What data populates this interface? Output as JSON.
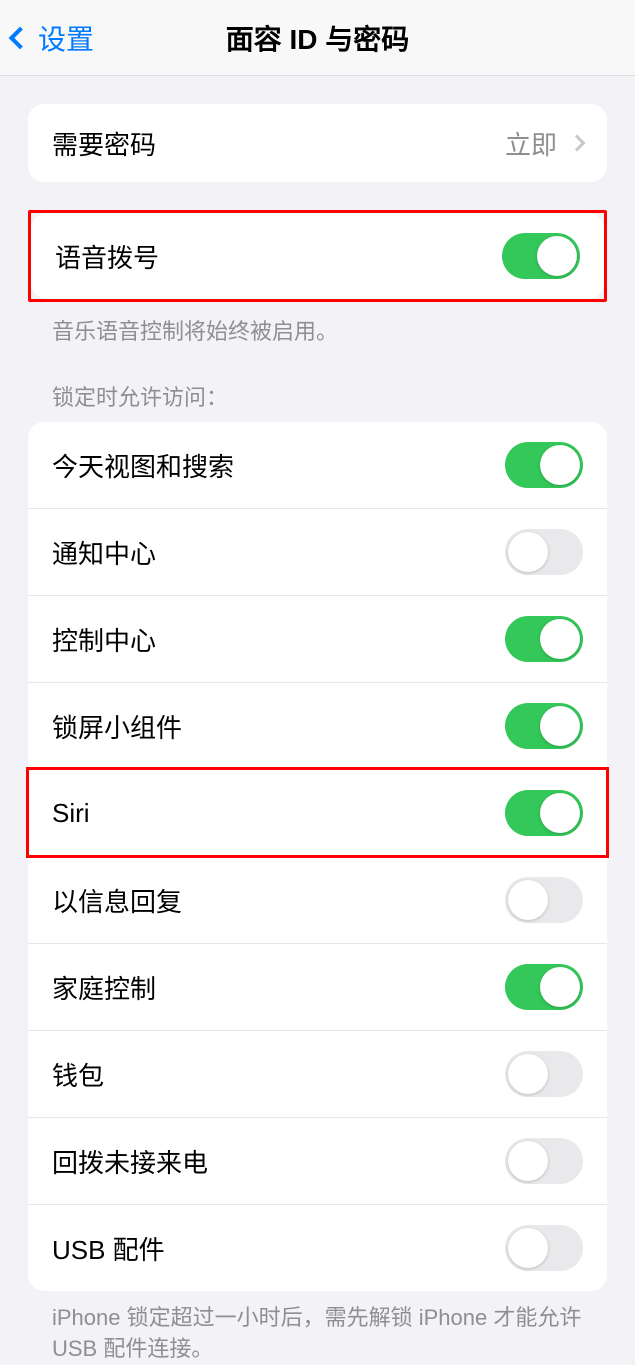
{
  "header": {
    "back_label": "设置",
    "title": "面容 ID 与密码"
  },
  "group_passcode": {
    "require_label": "需要密码",
    "require_value": "立即"
  },
  "group_voice": {
    "voice_dial_label": "语音拨号",
    "voice_dial_on": true,
    "footer": "音乐语音控制将始终被启用。"
  },
  "locked_access": {
    "header": "锁定时允许访问：",
    "items": [
      {
        "label": "今天视图和搜索",
        "on": true
      },
      {
        "label": "通知中心",
        "on": false
      },
      {
        "label": "控制中心",
        "on": true
      },
      {
        "label": "锁屏小组件",
        "on": true
      },
      {
        "label": "Siri",
        "on": true
      },
      {
        "label": "以信息回复",
        "on": false
      },
      {
        "label": "家庭控制",
        "on": true
      },
      {
        "label": "钱包",
        "on": false
      },
      {
        "label": "回拨未接来电",
        "on": false
      },
      {
        "label": "USB 配件",
        "on": false
      }
    ],
    "footer": "iPhone 锁定超过一小时后，需先解锁 iPhone 才能允许 USB 配件连接。"
  }
}
